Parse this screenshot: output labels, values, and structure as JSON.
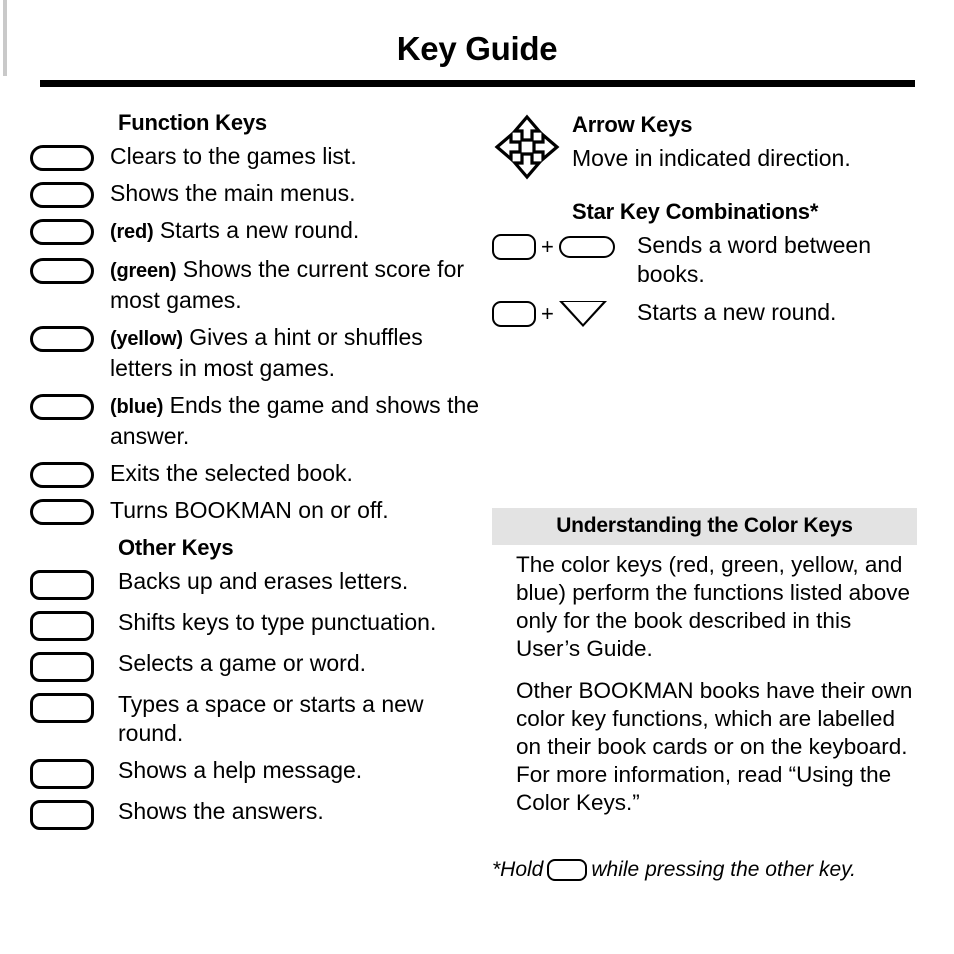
{
  "page": {
    "title": "Key Guide"
  },
  "left_column": {
    "function_keys": {
      "heading": "Function Keys",
      "rows": [
        {
          "key_icon": "rounded-key",
          "color_label": "",
          "description": "Clears to the games list."
        },
        {
          "key_icon": "rounded-key",
          "color_label": "",
          "description": "Shows the main menus."
        },
        {
          "key_icon": "rounded-key",
          "color_label": "(red)",
          "description": "Starts a new round."
        },
        {
          "key_icon": "rounded-key",
          "color_label": "(green)",
          "description": "Shows the current score for most games."
        },
        {
          "key_icon": "rounded-key",
          "color_label": "(yellow)",
          "description": "Gives a hint or shuffles letters in most games."
        },
        {
          "key_icon": "rounded-key",
          "color_label": "(blue)",
          "description": "Ends the game and shows the answer."
        },
        {
          "key_icon": "rounded-key",
          "color_label": "",
          "description": "Exits the selected book."
        },
        {
          "key_icon": "rounded-key",
          "color_label": "",
          "description": "Turns BOOKMAN on or off."
        }
      ]
    },
    "other_keys": {
      "heading": "Other Keys",
      "rows": [
        {
          "key_icon": "rounded-key",
          "description": "Backs up and erases letters."
        },
        {
          "key_icon": "rounded-key",
          "description": "Shifts keys to type punctuation."
        },
        {
          "key_icon": "rounded-key",
          "description": "Selects a game or word."
        },
        {
          "key_icon": "rounded-key",
          "description": "Types a space or starts a new round."
        },
        {
          "key_icon": "rounded-key",
          "description": "Shows a help message."
        },
        {
          "key_icon": "rounded-key",
          "description": "Shows the answers."
        }
      ]
    }
  },
  "right_column": {
    "arrow_keys": {
      "heading": "Arrow Keys",
      "icon": "four-way-arrow-icon",
      "description": "Move in indicated direction."
    },
    "star_key_combinations": {
      "heading": "Star Key Combinations*",
      "rows": [
        {
          "first_key": "rounded-key",
          "operator": "+",
          "second_key": "wide-rounded-key",
          "description": "Sends a word between books."
        },
        {
          "first_key": "rounded-key",
          "operator": "+",
          "second_key": "triangle-down-key",
          "description": "Starts a new round."
        }
      ]
    },
    "color_keys_panel": {
      "heading": "Understanding the Color Keys",
      "paragraphs": [
        "The color keys (red, green, yellow, and blue) perform the functions listed above only for the book described in this User’s Guide.",
        "Other BOOKMAN books have their own color key functions, which are labelled on their book cards or on the keyboard. For more information, read “Using the Color Keys.”"
      ]
    },
    "footnote": {
      "prefix": "*Hold",
      "key_icon": "rounded-key",
      "suffix": "while pressing the other key."
    }
  },
  "colors": {
    "ink": "#000000",
    "page": "#ffffff",
    "panel_header_bg": "#e3e3e3",
    "edge_strip": "#c9c9c9"
  }
}
